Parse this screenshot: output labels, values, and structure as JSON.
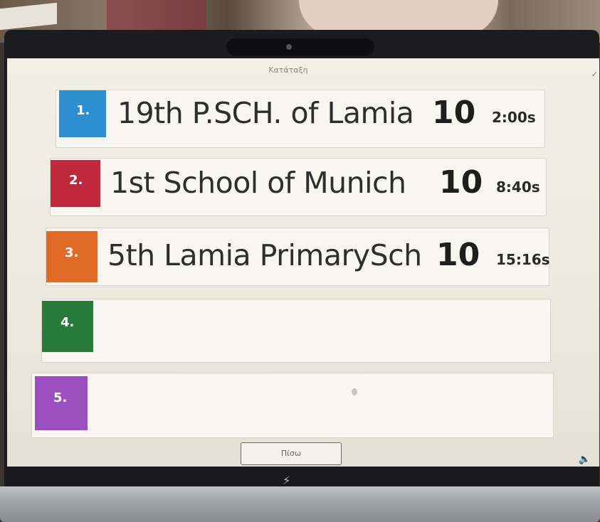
{
  "screen": {
    "title": "Κατάταξη"
  },
  "leaderboard": [
    {
      "rank": "1.",
      "team": "19th P.SCH. of Lamia",
      "score": "10",
      "time": "2:00s",
      "color": "#2b8fd0"
    },
    {
      "rank": "2.",
      "team": "1st School of Munich",
      "score": "10",
      "time": "8:40s",
      "color": "#c0283c"
    },
    {
      "rank": "3.",
      "team": "5th Lamia PrimarySch",
      "score": "10",
      "time": "15:16s",
      "color": "#e06a28"
    },
    {
      "rank": "4.",
      "team": "",
      "score": "",
      "time": "",
      "color": "#277a3a"
    },
    {
      "rank": "5.",
      "team": "",
      "score": "",
      "time": "",
      "color": "#9b4fbf"
    }
  ],
  "controls": {
    "next_label": "Πίσω"
  },
  "icons": {
    "check": "check-icon",
    "speaker": "speaker-icon",
    "flash": "flash-icon"
  }
}
